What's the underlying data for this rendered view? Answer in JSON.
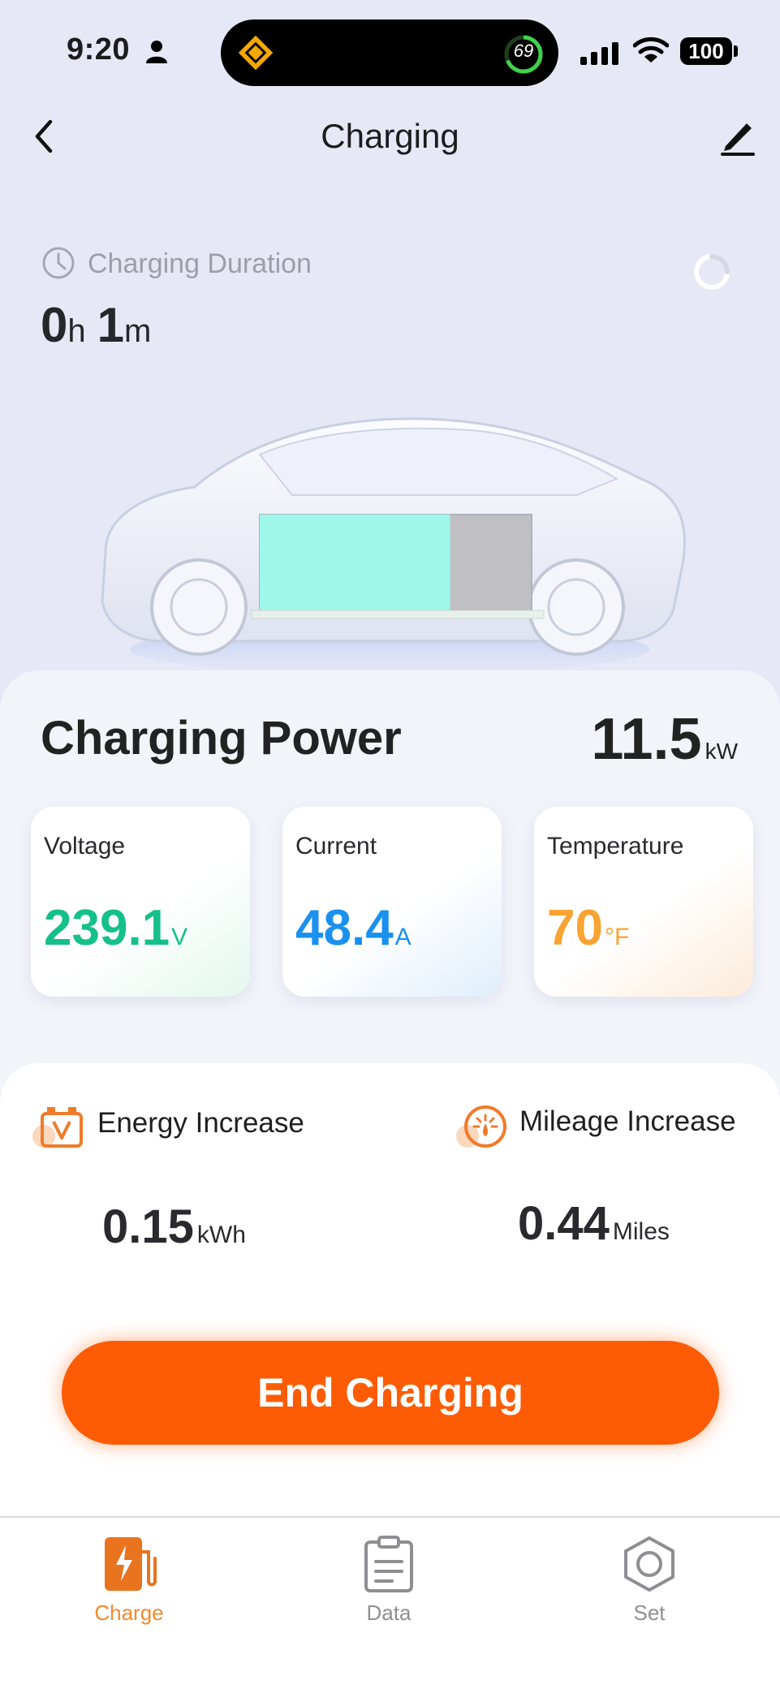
{
  "status_bar": {
    "time": "9:20",
    "island_ring_value": "69",
    "battery": "100"
  },
  "nav": {
    "title": "Charging"
  },
  "duration": {
    "label": "Charging Duration",
    "hours": "0",
    "hours_unit": "h",
    "minutes": "1",
    "minutes_unit": "m"
  },
  "battery_level_fraction": 0.7,
  "power": {
    "label": "Charging Power",
    "value": "11.5",
    "unit": "kW"
  },
  "metrics": {
    "voltage": {
      "label": "Voltage",
      "value": "239.1",
      "unit": "V"
    },
    "current": {
      "label": "Current",
      "value": "48.4",
      "unit": "A"
    },
    "temperature": {
      "label": "Temperature",
      "value": "70",
      "unit": "°F"
    }
  },
  "energy": {
    "label": "Energy Increase",
    "value": "0.15",
    "unit": "kWh"
  },
  "mileage": {
    "label": "Mileage Increase",
    "value": "0.44",
    "unit": "Miles"
  },
  "end_button_label": "End Charging",
  "tabs": [
    {
      "label": "Charge",
      "icon": "charger-icon",
      "active": true
    },
    {
      "label": "Data",
      "icon": "clipboard-icon",
      "active": false
    },
    {
      "label": "Set",
      "icon": "hexagon-gear-icon",
      "active": false
    }
  ],
  "colors": {
    "accent": "#fd5c04",
    "tab_active": "#f28a2c",
    "voltage": "#16c08a",
    "current": "#1a90ef",
    "temperature": "#f8a332",
    "battery_fill": "#9ff7ea",
    "background": "#e6e8f6"
  }
}
